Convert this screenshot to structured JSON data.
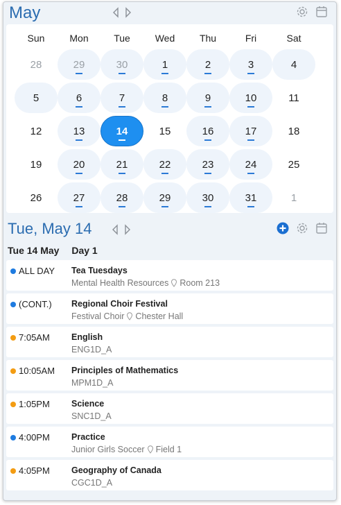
{
  "month_header": {
    "title": "May"
  },
  "weekdays": [
    "Sun",
    "Mon",
    "Tue",
    "Wed",
    "Thu",
    "Fri",
    "Sat"
  ],
  "weeks": [
    [
      {
        "n": "28",
        "other": true,
        "ev": false,
        "plain": true
      },
      {
        "n": "29",
        "other": true,
        "ev": true
      },
      {
        "n": "30",
        "other": true,
        "ev": true
      },
      {
        "n": "1",
        "ev": true
      },
      {
        "n": "2",
        "ev": true
      },
      {
        "n": "3",
        "ev": true
      },
      {
        "n": "4",
        "ev": false
      }
    ],
    [
      {
        "n": "5",
        "ev": false
      },
      {
        "n": "6",
        "ev": true
      },
      {
        "n": "7",
        "ev": true
      },
      {
        "n": "8",
        "ev": true
      },
      {
        "n": "9",
        "ev": true
      },
      {
        "n": "10",
        "ev": true
      },
      {
        "n": "11",
        "ev": false,
        "plain": true
      }
    ],
    [
      {
        "n": "12",
        "ev": false,
        "plain": true
      },
      {
        "n": "13",
        "ev": true
      },
      {
        "n": "14",
        "ev": true,
        "selected": true
      },
      {
        "n": "15",
        "ev": false,
        "plain": true
      },
      {
        "n": "16",
        "ev": true
      },
      {
        "n": "17",
        "ev": true
      },
      {
        "n": "18",
        "ev": false,
        "plain": true
      }
    ],
    [
      {
        "n": "19",
        "ev": false,
        "plain": true
      },
      {
        "n": "20",
        "ev": true
      },
      {
        "n": "21",
        "ev": true
      },
      {
        "n": "22",
        "ev": true
      },
      {
        "n": "23",
        "ev": true
      },
      {
        "n": "24",
        "ev": true
      },
      {
        "n": "25",
        "ev": false,
        "plain": true
      }
    ],
    [
      {
        "n": "26",
        "ev": false,
        "plain": true
      },
      {
        "n": "27",
        "ev": true
      },
      {
        "n": "28",
        "ev": true
      },
      {
        "n": "29",
        "ev": true
      },
      {
        "n": "30",
        "ev": true
      },
      {
        "n": "31",
        "ev": true
      },
      {
        "n": "1",
        "other": true,
        "ev": false,
        "plain": true
      }
    ]
  ],
  "day_header": {
    "title": "Tue, May 14",
    "date_label": "Tue 14 May",
    "rotation_label": "Day 1"
  },
  "events": [
    {
      "time": "ALL DAY",
      "title": "Tea Tuesdays",
      "detail": "Mental Health Resources",
      "location": "Room 213",
      "color": "#1e7be0"
    },
    {
      "time": "(CONT.)",
      "title": "Regional Choir Festival",
      "detail": "Festival Choir",
      "location": "Chester Hall",
      "color": "#1e7be0"
    },
    {
      "time": "7:05AM",
      "title": "English",
      "detail": "ENG1D_A",
      "location": "",
      "color": "#f39c12"
    },
    {
      "time": "10:05AM",
      "title": "Principles of Mathematics",
      "detail": "MPM1D_A",
      "location": "",
      "color": "#f39c12"
    },
    {
      "time": "1:05PM",
      "title": "Science",
      "detail": "SNC1D_A",
      "location": "",
      "color": "#f39c12"
    },
    {
      "time": "4:00PM",
      "title": "Practice",
      "detail": "Junior Girls Soccer",
      "location": "Field 1",
      "color": "#1e7be0"
    },
    {
      "time": "4:05PM",
      "title": "Geography of Canada",
      "detail": "CGC1D_A",
      "location": "",
      "color": "#f39c12"
    }
  ],
  "icons": {
    "prev": "chevron-left-icon",
    "next": "chevron-right-icon",
    "settings": "gear-icon",
    "calendar": "calendar-icon",
    "add": "add-circle-icon",
    "location": "map-pin-icon"
  },
  "colors": {
    "accent": "#2b6cb0",
    "selected": "#1e8ff0",
    "school_event": "#1e7be0",
    "class": "#f39c12"
  }
}
